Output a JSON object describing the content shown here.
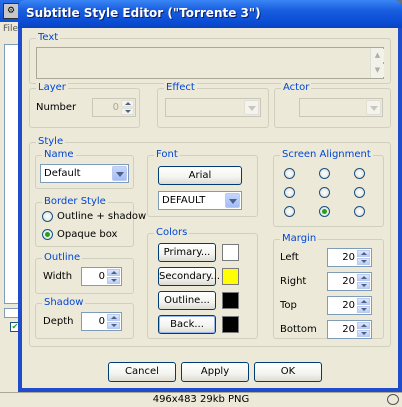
{
  "window": {
    "title": "Subtitle Style Editor (\"Torrente 3\")"
  },
  "background_app": {
    "menu_fragment": "File"
  },
  "text_group": {
    "label": "Text",
    "value": ""
  },
  "layer_group": {
    "label": "Layer",
    "number_label": "Number",
    "number_value": "0"
  },
  "effect_group": {
    "label": "Effect",
    "value": ""
  },
  "actor_group": {
    "label": "Actor",
    "value": ""
  },
  "style_group": {
    "label": "Style",
    "name": {
      "label": "Name",
      "value": "Default"
    },
    "border_style": {
      "label": "Border Style",
      "options": [
        "Outline + shadow",
        "Opaque box"
      ],
      "selected": "Opaque box"
    },
    "outline": {
      "label": "Outline",
      "width_label": "Width",
      "width_value": "0"
    },
    "shadow": {
      "label": "Shadow",
      "depth_label": "Depth",
      "depth_value": "0"
    },
    "font": {
      "label": "Font",
      "button_label": "Arial",
      "charset": "DEFAULT"
    },
    "colors": {
      "label": "Colors",
      "items": [
        {
          "label": "Primary...",
          "color": "#ffffff"
        },
        {
          "label": "Secondary...",
          "color": "#ffff00"
        },
        {
          "label": "Outline...",
          "color": "#000000"
        },
        {
          "label": "Back...",
          "color": "#000000"
        }
      ]
    },
    "screen_alignment": {
      "label": "Screen Alignment",
      "selected_index": 7
    },
    "margin": {
      "label": "Margin",
      "left_label": "Left",
      "left_value": "20",
      "right_label": "Right",
      "right_value": "20",
      "top_label": "Top",
      "top_value": "20",
      "bottom_label": "Bottom",
      "bottom_value": "20"
    }
  },
  "buttons": {
    "cancel": "Cancel",
    "apply": "Apply",
    "ok": "OK"
  },
  "status_bar": {
    "caption": "496x483  29kb  PNG"
  }
}
